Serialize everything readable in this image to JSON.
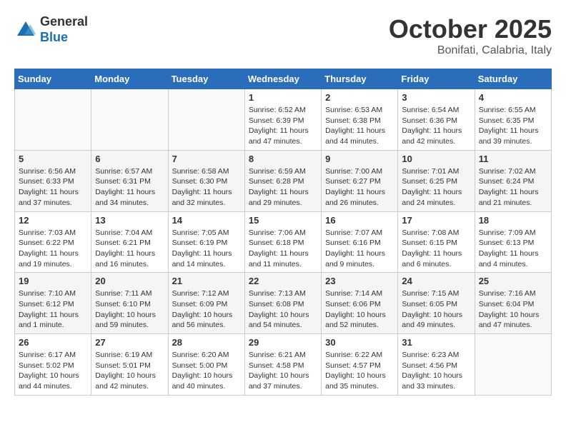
{
  "header": {
    "logo_line1": "General",
    "logo_line2": "Blue",
    "month_title": "October 2025",
    "location": "Bonifati, Calabria, Italy"
  },
  "days_of_week": [
    "Sunday",
    "Monday",
    "Tuesday",
    "Wednesday",
    "Thursday",
    "Friday",
    "Saturday"
  ],
  "weeks": [
    [
      {
        "day": "",
        "info": ""
      },
      {
        "day": "",
        "info": ""
      },
      {
        "day": "",
        "info": ""
      },
      {
        "day": "1",
        "info": "Sunrise: 6:52 AM\nSunset: 6:39 PM\nDaylight: 11 hours and 47 minutes."
      },
      {
        "day": "2",
        "info": "Sunrise: 6:53 AM\nSunset: 6:38 PM\nDaylight: 11 hours and 44 minutes."
      },
      {
        "day": "3",
        "info": "Sunrise: 6:54 AM\nSunset: 6:36 PM\nDaylight: 11 hours and 42 minutes."
      },
      {
        "day": "4",
        "info": "Sunrise: 6:55 AM\nSunset: 6:35 PM\nDaylight: 11 hours and 39 minutes."
      }
    ],
    [
      {
        "day": "5",
        "info": "Sunrise: 6:56 AM\nSunset: 6:33 PM\nDaylight: 11 hours and 37 minutes."
      },
      {
        "day": "6",
        "info": "Sunrise: 6:57 AM\nSunset: 6:31 PM\nDaylight: 11 hours and 34 minutes."
      },
      {
        "day": "7",
        "info": "Sunrise: 6:58 AM\nSunset: 6:30 PM\nDaylight: 11 hours and 32 minutes."
      },
      {
        "day": "8",
        "info": "Sunrise: 6:59 AM\nSunset: 6:28 PM\nDaylight: 11 hours and 29 minutes."
      },
      {
        "day": "9",
        "info": "Sunrise: 7:00 AM\nSunset: 6:27 PM\nDaylight: 11 hours and 26 minutes."
      },
      {
        "day": "10",
        "info": "Sunrise: 7:01 AM\nSunset: 6:25 PM\nDaylight: 11 hours and 24 minutes."
      },
      {
        "day": "11",
        "info": "Sunrise: 7:02 AM\nSunset: 6:24 PM\nDaylight: 11 hours and 21 minutes."
      }
    ],
    [
      {
        "day": "12",
        "info": "Sunrise: 7:03 AM\nSunset: 6:22 PM\nDaylight: 11 hours and 19 minutes."
      },
      {
        "day": "13",
        "info": "Sunrise: 7:04 AM\nSunset: 6:21 PM\nDaylight: 11 hours and 16 minutes."
      },
      {
        "day": "14",
        "info": "Sunrise: 7:05 AM\nSunset: 6:19 PM\nDaylight: 11 hours and 14 minutes."
      },
      {
        "day": "15",
        "info": "Sunrise: 7:06 AM\nSunset: 6:18 PM\nDaylight: 11 hours and 11 minutes."
      },
      {
        "day": "16",
        "info": "Sunrise: 7:07 AM\nSunset: 6:16 PM\nDaylight: 11 hours and 9 minutes."
      },
      {
        "day": "17",
        "info": "Sunrise: 7:08 AM\nSunset: 6:15 PM\nDaylight: 11 hours and 6 minutes."
      },
      {
        "day": "18",
        "info": "Sunrise: 7:09 AM\nSunset: 6:13 PM\nDaylight: 11 hours and 4 minutes."
      }
    ],
    [
      {
        "day": "19",
        "info": "Sunrise: 7:10 AM\nSunset: 6:12 PM\nDaylight: 11 hours and 1 minute."
      },
      {
        "day": "20",
        "info": "Sunrise: 7:11 AM\nSunset: 6:10 PM\nDaylight: 10 hours and 59 minutes."
      },
      {
        "day": "21",
        "info": "Sunrise: 7:12 AM\nSunset: 6:09 PM\nDaylight: 10 hours and 56 minutes."
      },
      {
        "day": "22",
        "info": "Sunrise: 7:13 AM\nSunset: 6:08 PM\nDaylight: 10 hours and 54 minutes."
      },
      {
        "day": "23",
        "info": "Sunrise: 7:14 AM\nSunset: 6:06 PM\nDaylight: 10 hours and 52 minutes."
      },
      {
        "day": "24",
        "info": "Sunrise: 7:15 AM\nSunset: 6:05 PM\nDaylight: 10 hours and 49 minutes."
      },
      {
        "day": "25",
        "info": "Sunrise: 7:16 AM\nSunset: 6:04 PM\nDaylight: 10 hours and 47 minutes."
      }
    ],
    [
      {
        "day": "26",
        "info": "Sunrise: 6:17 AM\nSunset: 5:02 PM\nDaylight: 10 hours and 44 minutes."
      },
      {
        "day": "27",
        "info": "Sunrise: 6:19 AM\nSunset: 5:01 PM\nDaylight: 10 hours and 42 minutes."
      },
      {
        "day": "28",
        "info": "Sunrise: 6:20 AM\nSunset: 5:00 PM\nDaylight: 10 hours and 40 minutes."
      },
      {
        "day": "29",
        "info": "Sunrise: 6:21 AM\nSunset: 4:58 PM\nDaylight: 10 hours and 37 minutes."
      },
      {
        "day": "30",
        "info": "Sunrise: 6:22 AM\nSunset: 4:57 PM\nDaylight: 10 hours and 35 minutes."
      },
      {
        "day": "31",
        "info": "Sunrise: 6:23 AM\nSunset: 4:56 PM\nDaylight: 10 hours and 33 minutes."
      },
      {
        "day": "",
        "info": ""
      }
    ]
  ]
}
